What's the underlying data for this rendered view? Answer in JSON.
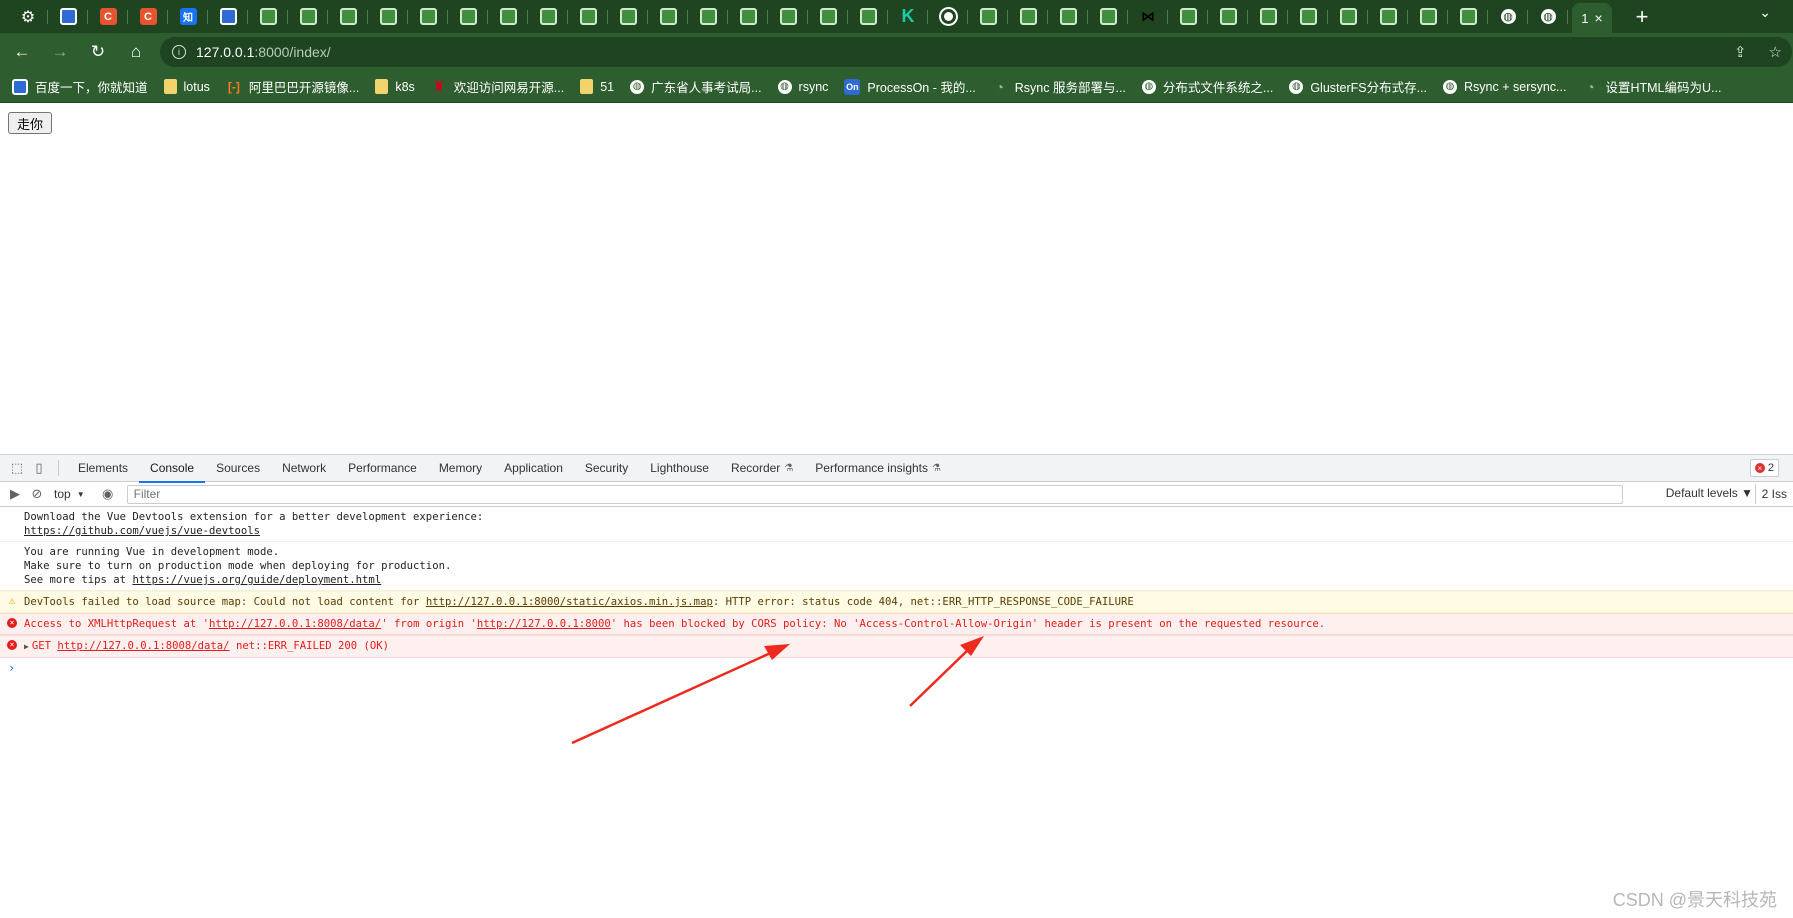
{
  "browser": {
    "tabs": [
      {
        "icon": "gear-icon",
        "glyph": "⚙",
        "kind": "gear"
      },
      {
        "icon": "baidu-icon",
        "glyph": "",
        "kind": "baidu"
      },
      {
        "icon": "csdn-icon",
        "glyph": "C",
        "kind": "csdn"
      },
      {
        "icon": "csdn-icon",
        "glyph": "C",
        "kind": "csdn"
      },
      {
        "icon": "zhihu-icon",
        "glyph": "知",
        "kind": "zhihu"
      },
      {
        "icon": "baidu-icon",
        "glyph": "",
        "kind": "baidu"
      },
      {
        "icon": "pycharm-icon",
        "glyph": "",
        "kind": "py"
      },
      {
        "icon": "pycharm-icon",
        "glyph": "",
        "kind": "py"
      },
      {
        "icon": "pycharm-icon",
        "glyph": "",
        "kind": "py"
      },
      {
        "icon": "pycharm-icon",
        "glyph": "",
        "kind": "py"
      },
      {
        "icon": "pycharm-icon",
        "glyph": "",
        "kind": "py"
      },
      {
        "icon": "pycharm-icon",
        "glyph": "",
        "kind": "py"
      },
      {
        "icon": "pycharm-icon",
        "glyph": "",
        "kind": "py"
      },
      {
        "icon": "pycharm-icon",
        "glyph": "",
        "kind": "py"
      },
      {
        "icon": "pycharm-icon",
        "glyph": "",
        "kind": "py"
      },
      {
        "icon": "pycharm-icon",
        "glyph": "",
        "kind": "py"
      },
      {
        "icon": "pycharm-icon",
        "glyph": "",
        "kind": "py"
      },
      {
        "icon": "pycharm-icon",
        "glyph": "",
        "kind": "py"
      },
      {
        "icon": "pycharm-icon",
        "glyph": "",
        "kind": "py"
      },
      {
        "icon": "pycharm-icon",
        "glyph": "",
        "kind": "py"
      },
      {
        "icon": "pycharm-icon",
        "glyph": "",
        "kind": "py"
      },
      {
        "icon": "pycharm-icon",
        "glyph": "",
        "kind": "py"
      },
      {
        "icon": "k-icon",
        "glyph": "K",
        "kind": "kk"
      },
      {
        "icon": "chrome-icon",
        "glyph": "",
        "kind": "chrome"
      },
      {
        "icon": "pycharm-icon",
        "glyph": "",
        "kind": "py"
      },
      {
        "icon": "pycharm-icon",
        "glyph": "",
        "kind": "py"
      },
      {
        "icon": "pycharm-icon",
        "glyph": "",
        "kind": "py"
      },
      {
        "icon": "pycharm-icon",
        "glyph": "",
        "kind": "py"
      },
      {
        "icon": "bow-tie-icon",
        "glyph": "⋈",
        "kind": "bow"
      },
      {
        "icon": "pycharm-icon",
        "glyph": "",
        "kind": "py"
      },
      {
        "icon": "pycharm-icon",
        "glyph": "",
        "kind": "py"
      },
      {
        "icon": "pycharm-icon",
        "glyph": "",
        "kind": "py"
      },
      {
        "icon": "pycharm-icon",
        "glyph": "",
        "kind": "py"
      },
      {
        "icon": "pycharm-icon",
        "glyph": "",
        "kind": "py"
      },
      {
        "icon": "pycharm-icon",
        "glyph": "",
        "kind": "py"
      },
      {
        "icon": "pycharm-icon",
        "glyph": "",
        "kind": "py"
      },
      {
        "icon": "pycharm-icon",
        "glyph": "",
        "kind": "py"
      },
      {
        "icon": "globe-icon",
        "glyph": "◍",
        "kind": "globe"
      },
      {
        "icon": "globe-icon",
        "glyph": "◍",
        "kind": "globe"
      }
    ],
    "active_tab_label": "1",
    "close_glyph": "×",
    "new_tab_glyph": "+",
    "tab_menu_glyph": "⌄",
    "back_glyph": "←",
    "forward_glyph": "→",
    "reload_glyph": "↻",
    "home_glyph": "⌂",
    "url_host": "127.0.0.1",
    "url_path": ":8000/index/",
    "share_glyph": "⇪",
    "star_glyph": "☆",
    "bookmarks": [
      {
        "label": "百度一下，你就知道",
        "icon": "baidu-icon",
        "kind": "baidu",
        "glyph": ""
      },
      {
        "label": "lotus",
        "icon": "folder-icon",
        "kind": "folder",
        "glyph": ""
      },
      {
        "label": "阿里巴巴开源镜像...",
        "icon": "alibaba-icon",
        "kind": "ali",
        "glyph": "[-]"
      },
      {
        "label": "k8s",
        "icon": "folder-icon",
        "kind": "folder",
        "glyph": ""
      },
      {
        "label": "欢迎访问网易开源...",
        "icon": "netease-icon",
        "kind": "netease",
        "glyph": "♜"
      },
      {
        "label": "51",
        "icon": "folder-icon",
        "kind": "folder",
        "glyph": ""
      },
      {
        "label": "广东省人事考试局...",
        "icon": "globe-icon",
        "kind": "globe",
        "glyph": "◍"
      },
      {
        "label": "rsync",
        "icon": "globe-icon",
        "kind": "globe",
        "glyph": "◍"
      },
      {
        "label": "ProcessOn - 我的...",
        "icon": "processon-icon",
        "kind": "on",
        "glyph": "On"
      },
      {
        "label": "Rsync 服务部署与...",
        "icon": "github-icon",
        "kind": "github",
        "glyph": "◔"
      },
      {
        "label": "分布式文件系统之...",
        "icon": "globe-icon",
        "kind": "globe",
        "glyph": "◍"
      },
      {
        "label": "GlusterFS分布式存...",
        "icon": "globe-icon",
        "kind": "globe",
        "glyph": "◍"
      },
      {
        "label": "Rsync + sersync...",
        "icon": "globe-icon",
        "kind": "globe",
        "glyph": "◍"
      },
      {
        "label": "设置HTML编码为U...",
        "icon": "github-icon",
        "kind": "github",
        "glyph": "◔"
      }
    ]
  },
  "page": {
    "button_label": "走你"
  },
  "devtools": {
    "inspect_glyph": "⬚",
    "device_glyph": "▯",
    "tabs": [
      {
        "label": "Elements",
        "active": false,
        "flask": false
      },
      {
        "label": "Console",
        "active": true,
        "flask": false
      },
      {
        "label": "Sources",
        "active": false,
        "flask": false
      },
      {
        "label": "Network",
        "active": false,
        "flask": false
      },
      {
        "label": "Performance",
        "active": false,
        "flask": false
      },
      {
        "label": "Memory",
        "active": false,
        "flask": false
      },
      {
        "label": "Application",
        "active": false,
        "flask": false
      },
      {
        "label": "Security",
        "active": false,
        "flask": false
      },
      {
        "label": "Lighthouse",
        "active": false,
        "flask": false
      },
      {
        "label": "Recorder",
        "active": false,
        "flask": true
      },
      {
        "label": "Performance insights",
        "active": false,
        "flask": true
      }
    ],
    "flask_glyph": "⚗",
    "error_count": "2",
    "error_glyph": "×",
    "sidebar_glyph": "▶",
    "clear_glyph": "⊘",
    "context": "top",
    "context_caret": "▼",
    "eye_glyph": "◉",
    "filter_placeholder": "Filter",
    "levels_label": "Default levels ▼",
    "issues_label": "2 Iss",
    "messages": {
      "m1_text": "Download the Vue Devtools extension for a better development experience:",
      "m1_link": "https://github.com/vuejs/vue-devtools",
      "m2_line1": "You are running Vue in development mode.",
      "m2_line2": "Make sure to turn on production mode when deploying for production.",
      "m2_prefix": "See more tips at ",
      "m2_link": "https://vuejs.org/guide/deployment.html",
      "w_prefix": "DevTools failed to load source map: Could not load content for ",
      "w_link": "http://127.0.0.1:8000/static/axios.min.js.map",
      "w_suffix": ": HTTP error: status code 404, net::ERR_HTTP_RESPONSE_CODE_FAILURE",
      "w_glyph": "⚠",
      "e1_a": "Access to XMLHttpRequest at '",
      "e1_link1": "http://127.0.0.1:8008/data/",
      "e1_b": "' from origin '",
      "e1_link2": "http://127.0.0.1:8000",
      "e1_c": "' has been blocked by CORS policy: No 'Access-Control-Allow-Origin' header is present on the requested resource.",
      "e2_caret": "▶",
      "e2_method": "GET ",
      "e2_link": "http://127.0.0.1:8008/data/",
      "e2_suffix": " net::ERR_FAILED 200 (OK)",
      "err_glyph": "×",
      "prompt": "›"
    }
  },
  "annotation_color": "#ee2a1f",
  "watermark": "CSDN @景天科技苑"
}
